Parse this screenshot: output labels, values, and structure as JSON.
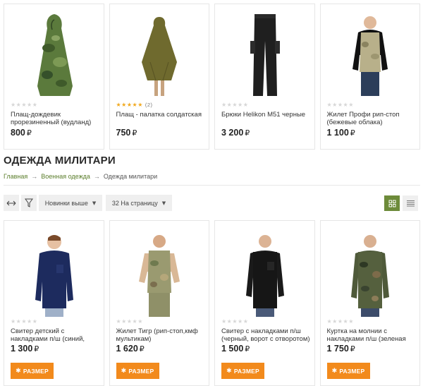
{
  "top_products": [
    {
      "name": "Плащ-дождевик прорезиненный (вудланд)",
      "price": "800",
      "currency": "₽",
      "stars_filled": 0,
      "review_count": "",
      "image": "camo-poncho"
    },
    {
      "name": "Плащ - палатка солдатская",
      "price": "750",
      "currency": "₽",
      "stars_filled": 5,
      "review_count": "(2)",
      "image": "olive-cape"
    },
    {
      "name": "Брюки Helikon M51 черные",
      "price": "3 200",
      "currency": "₽",
      "stars_filled": 0,
      "review_count": "",
      "image": "black-trousers"
    },
    {
      "name": "Жилет Профи рип-стоп (бежевые облака)",
      "price": "1 100",
      "currency": "₽",
      "stars_filled": 0,
      "review_count": "",
      "image": "camo-vest-man"
    }
  ],
  "category": {
    "title": "ОДЕЖДА МИЛИТАРИ",
    "breadcrumb": [
      "Главная",
      "Военная одежда",
      "Одежда милитари"
    ],
    "breadcrumb_sep": "→"
  },
  "toolbar": {
    "sort_label": "Новинки выше",
    "per_page_label": "32 На страницу",
    "active_view": "grid"
  },
  "products": [
    {
      "name": "Свитер детский с накладками п/ш (синий,",
      "price": "1 300",
      "currency": "₽",
      "stars_filled": 0,
      "button": "РАЗМЕР",
      "image": "navy-sweater-child"
    },
    {
      "name": "Жилет Тигр (рип-стоп,кмф мультикам)",
      "price": "1 620",
      "currency": "₽",
      "stars_filled": 0,
      "button": "РАЗМЕР",
      "image": "multicam-vest-man"
    },
    {
      "name": "Свитер с накладками п/ш (черный, ворот с отворотом)",
      "price": "1 500",
      "currency": "₽",
      "stars_filled": 0,
      "button": "РАЗМЕР",
      "image": "black-sweater-man"
    },
    {
      "name": "Куртка на молнии с накладками п/ш (зеленая",
      "price": "1 750",
      "currency": "₽",
      "stars_filled": 0,
      "button": "РАЗМЕР",
      "image": "camo-jacket-man"
    }
  ],
  "colors": {
    "accent_orange": "#f28a1c",
    "accent_green": "#6d8b3a",
    "link_green": "#5a7d2a",
    "star_gold": "#f1a81c"
  }
}
